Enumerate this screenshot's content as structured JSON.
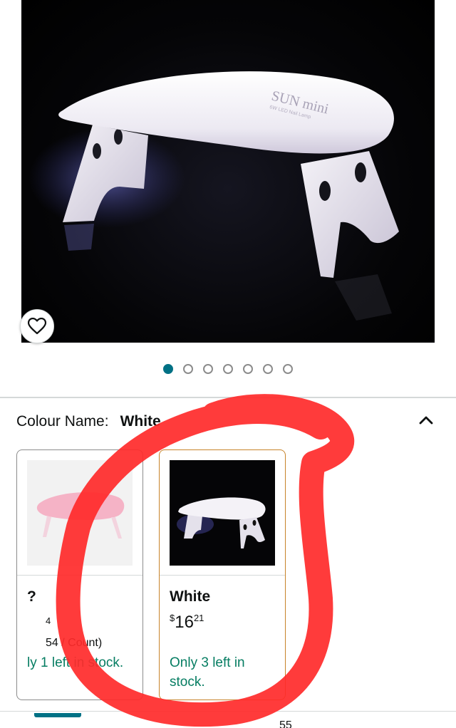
{
  "product": {
    "image_label": "SUN mini",
    "image_sublabel": "6W LED Nail Lamp",
    "gallery": {
      "count": 7,
      "active_index": 0
    }
  },
  "variation": {
    "label": "Colour Name:",
    "selected": "White"
  },
  "options": [
    {
      "name": "?",
      "price_whole": "",
      "price_fraction": "4",
      "unit_price": "54 / Count)",
      "stock": "ly 1 left in stock.",
      "selected": false
    },
    {
      "name": "White",
      "price_symbol": "$",
      "price_whole": "16",
      "price_fraction": "21",
      "stock": "Only 3 left in stock.",
      "selected": true
    }
  ],
  "bottom": {
    "partial_text": "55"
  },
  "icons": {
    "favorite": "heart-outline-icon",
    "collapse": "chevron-up-icon"
  },
  "colors": {
    "accent": "#007185",
    "selected_border": "#c7832a",
    "in_stock": "#067d62",
    "annotation": "#ff2a2a"
  }
}
